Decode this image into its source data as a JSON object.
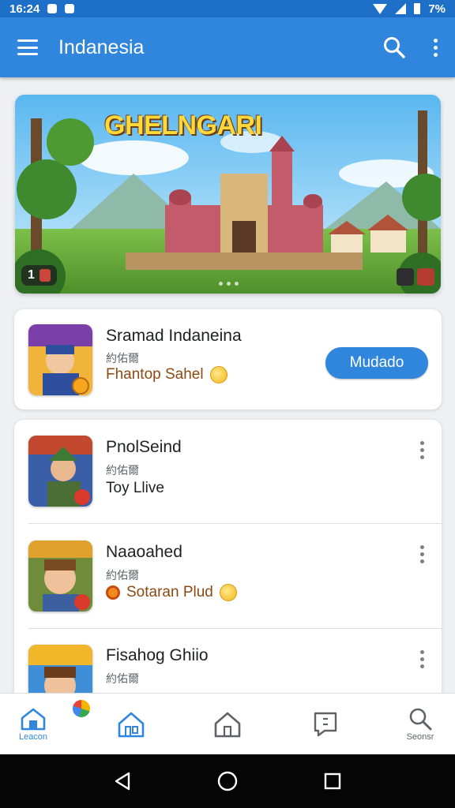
{
  "status_bar": {
    "time": "16:24",
    "battery": "7%"
  },
  "app_bar": {
    "title": "Indanesia"
  },
  "banner": {
    "title": "GHELNGARI",
    "badge_left": "1"
  },
  "featured": {
    "name": "Sramad Indaneina",
    "meta": "約佑爾",
    "subtitle": "Fhantop Sahel",
    "button_label": "Mudado"
  },
  "apps": [
    {
      "name": "PnolSeind",
      "meta": "約佑爾",
      "subtitle": "Toy Llive"
    },
    {
      "name": "Naaoahed",
      "meta": "約佑爾",
      "subtitle": "Sotaran Plud"
    },
    {
      "name": "Fisahog Ghiio",
      "meta": "約佑爾",
      "subtitle": ""
    }
  ],
  "bottom_nav": {
    "home_label": "Leacon",
    "search_label": "Seonsr"
  },
  "colors": {
    "primary": "#2f86dc",
    "status_bar": "#1e6fc8"
  }
}
